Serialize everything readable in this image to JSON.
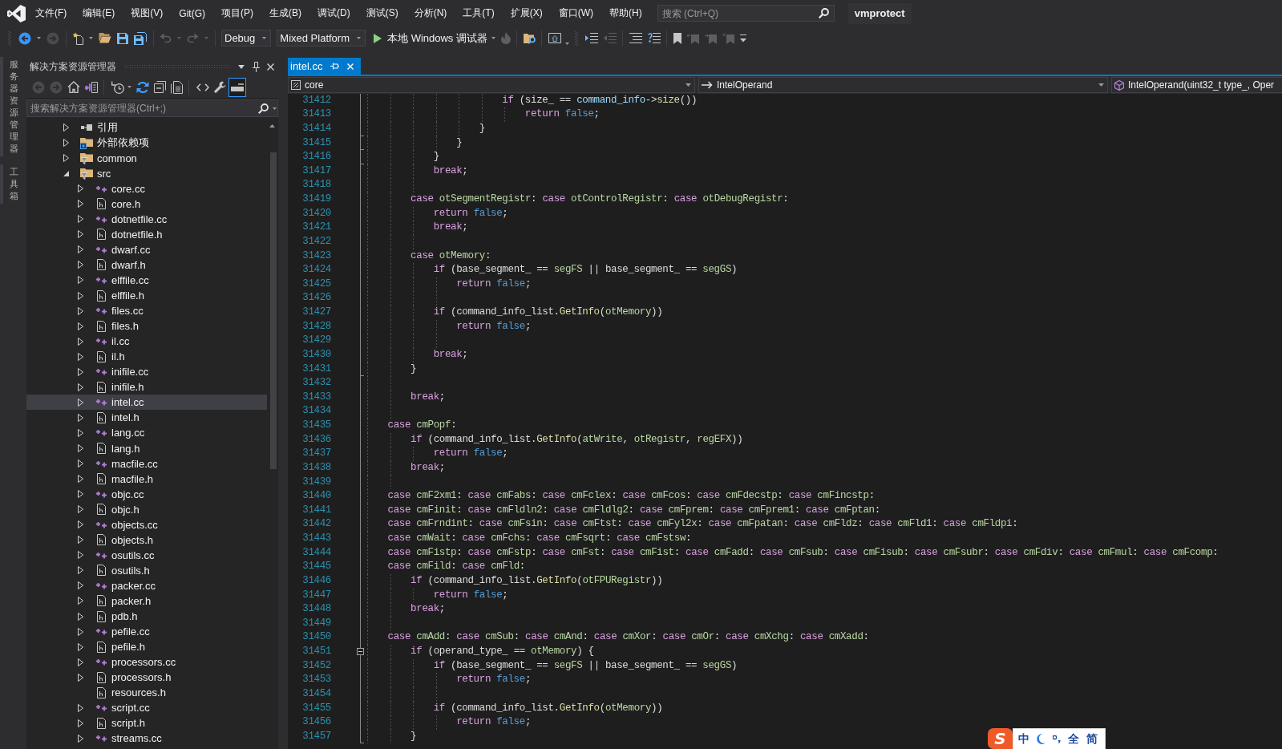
{
  "menu_bar": {
    "items": [
      "文件(F)",
      "编辑(E)",
      "视图(V)",
      "Git(G)",
      "项目(P)",
      "生成(B)",
      "调试(D)",
      "测试(S)",
      "分析(N)",
      "工具(T)",
      "扩展(X)",
      "窗口(W)",
      "帮助(H)"
    ],
    "search": {
      "placeholder": "搜索 (Ctrl+Q)"
    },
    "solution_name": "vmprotect"
  },
  "toolbars": [
    {
      "groups": [
        {
          "items": [
            {
              "kind": "back",
              "disabled": false
            },
            {
              "kind": "forward",
              "disabled": true
            }
          ]
        },
        {
          "items": [
            {
              "kind": "new-item",
              "disabled": false
            },
            {
              "kind": "open",
              "disabled": false
            },
            {
              "kind": "save",
              "disabled": false
            },
            {
              "kind": "save-all",
              "disabled": false
            }
          ]
        },
        {
          "items": [
            {
              "kind": "undo",
              "disabled": true
            },
            {
              "kind": "redo",
              "disabled": true
            }
          ]
        },
        {
          "items": [
            {
              "kind": "dropdown",
              "value": "Debug",
              "disabled": false
            },
            {
              "kind": "dropdown",
              "value": "Mixed Platform",
              "disabled": false
            },
            {
              "kind": "start",
              "label": "本地 Windows 调试器",
              "disabled": false
            },
            {
              "kind": "hot-reload",
              "disabled": true
            }
          ]
        },
        {
          "items": [
            {
              "kind": "find-in-files",
              "disabled": false
            }
          ]
        },
        {
          "items": [
            {
              "kind": "browser-link",
              "disabled": false
            }
          ]
        }
      ]
    },
    {
      "groups": [
        {
          "items": [
            {
              "kind": "indent",
              "disabled": false
            },
            {
              "kind": "outdent",
              "disabled": true
            }
          ]
        },
        {
          "items": [
            {
              "kind": "comment",
              "disabled": false
            },
            {
              "kind": "uncomment",
              "disabled": false
            }
          ]
        },
        {
          "items": [
            {
              "kind": "bookmark",
              "disabled": false
            },
            {
              "kind": "previous-bookmark",
              "disabled": true
            },
            {
              "kind": "next-bookmark",
              "disabled": true
            },
            {
              "kind": "clear-bookmarks",
              "disabled": true
            },
            {
              "kind": "options",
              "disabled": false
            }
          ]
        }
      ]
    }
  ],
  "side_tabs": [
    "服务器资源管理器",
    "工具箱"
  ],
  "solution_explorer": {
    "title": "解决方案资源管理器",
    "toolbar": {
      "groups": [
        {
          "items": [
            {
              "kind": "back",
              "disabled": true,
              "pressed": false
            },
            {
              "kind": "forward",
              "disabled": true,
              "pressed": false
            },
            {
              "kind": "home",
              "disabled": false,
              "pressed": false
            },
            {
              "kind": "switch-views",
              "disabled": false,
              "pressed": false
            }
          ]
        },
        {
          "items": [
            {
              "kind": "history",
              "disabled": false,
              "pressed": false
            },
            {
              "kind": "sync",
              "disabled": false,
              "pressed": false
            },
            {
              "kind": "collapse-all",
              "disabled": false,
              "pressed": false
            },
            {
              "kind": "show-all-files",
              "disabled": false,
              "pressed": false
            }
          ]
        },
        {
          "items": [
            {
              "kind": "code",
              "disabled": false,
              "pressed": false
            },
            {
              "kind": "properties",
              "disabled": false,
              "pressed": false
            },
            {
              "kind": "preview",
              "disabled": false,
              "pressed": true
            }
          ]
        }
      ]
    },
    "search": {
      "placeholder": "搜索解决方案资源管理器(Ctrl+;)"
    },
    "tree": [
      {
        "label": "引用",
        "kind": "references",
        "expandable": true,
        "expanded": false,
        "selected": false
      },
      {
        "label": "外部依赖项",
        "kind": "external",
        "expandable": true,
        "expanded": false,
        "selected": false
      },
      {
        "label": "common",
        "kind": "filter",
        "expandable": true,
        "expanded": false,
        "selected": false
      },
      {
        "label": "src",
        "kind": "filter",
        "expandable": true,
        "expanded": true,
        "selected": false,
        "children": [
          {
            "label": "core.cc",
            "kind": "source",
            "expandable": true,
            "expanded": false,
            "selected": false
          },
          {
            "label": "core.h",
            "kind": "header",
            "expandable": true,
            "expanded": false,
            "selected": false
          },
          {
            "label": "dotnetfile.cc",
            "kind": "source",
            "expandable": true,
            "expanded": false,
            "selected": false
          },
          {
            "label": "dotnetfile.h",
            "kind": "header",
            "expandable": true,
            "expanded": false,
            "selected": false
          },
          {
            "label": "dwarf.cc",
            "kind": "source",
            "expandable": true,
            "expanded": false,
            "selected": false
          },
          {
            "label": "dwarf.h",
            "kind": "header",
            "expandable": true,
            "expanded": false,
            "selected": false
          },
          {
            "label": "elffile.cc",
            "kind": "source",
            "expandable": true,
            "expanded": false,
            "selected": false
          },
          {
            "label": "elffile.h",
            "kind": "header",
            "expandable": true,
            "expanded": false,
            "selected": false
          },
          {
            "label": "files.cc",
            "kind": "source",
            "expandable": true,
            "expanded": false,
            "selected": false
          },
          {
            "label": "files.h",
            "kind": "header",
            "expandable": true,
            "expanded": false,
            "selected": false
          },
          {
            "label": "il.cc",
            "kind": "source",
            "expandable": true,
            "expanded": false,
            "selected": false
          },
          {
            "label": "il.h",
            "kind": "header",
            "expandable": true,
            "expanded": false,
            "selected": false
          },
          {
            "label": "inifile.cc",
            "kind": "source",
            "expandable": true,
            "expanded": false,
            "selected": false
          },
          {
            "label": "inifile.h",
            "kind": "header",
            "expandable": true,
            "expanded": false,
            "selected": false
          },
          {
            "label": "intel.cc",
            "kind": "source",
            "expandable": true,
            "expanded": false,
            "selected": true
          },
          {
            "label": "intel.h",
            "kind": "header",
            "expandable": true,
            "expanded": false,
            "selected": false
          },
          {
            "label": "lang.cc",
            "kind": "source",
            "expandable": true,
            "expanded": false,
            "selected": false
          },
          {
            "label": "lang.h",
            "kind": "header",
            "expandable": true,
            "expanded": false,
            "selected": false
          },
          {
            "label": "macfile.cc",
            "kind": "source",
            "expandable": true,
            "expanded": false,
            "selected": false
          },
          {
            "label": "macfile.h",
            "kind": "header",
            "expandable": true,
            "expanded": false,
            "selected": false
          },
          {
            "label": "objc.cc",
            "kind": "source",
            "expandable": true,
            "expanded": false,
            "selected": false
          },
          {
            "label": "objc.h",
            "kind": "header",
            "expandable": true,
            "expanded": false,
            "selected": false
          },
          {
            "label": "objects.cc",
            "kind": "source",
            "expandable": true,
            "expanded": false,
            "selected": false
          },
          {
            "label": "objects.h",
            "kind": "header",
            "expandable": true,
            "expanded": false,
            "selected": false
          },
          {
            "label": "osutils.cc",
            "kind": "source",
            "expandable": true,
            "expanded": false,
            "selected": false
          },
          {
            "label": "osutils.h",
            "kind": "header",
            "expandable": true,
            "expanded": false,
            "selected": false
          },
          {
            "label": "packer.cc",
            "kind": "source",
            "expandable": true,
            "expanded": false,
            "selected": false
          },
          {
            "label": "packer.h",
            "kind": "header",
            "expandable": true,
            "expanded": false,
            "selected": false
          },
          {
            "label": "pdb.h",
            "kind": "header",
            "expandable": true,
            "expanded": false,
            "selected": false
          },
          {
            "label": "pefile.cc",
            "kind": "source",
            "expandable": true,
            "expanded": false,
            "selected": false
          },
          {
            "label": "pefile.h",
            "kind": "header",
            "expandable": true,
            "expanded": false,
            "selected": false
          },
          {
            "label": "processors.cc",
            "kind": "source",
            "expandable": true,
            "expanded": false,
            "selected": false
          },
          {
            "label": "processors.h",
            "kind": "header",
            "expandable": true,
            "expanded": false,
            "selected": false
          },
          {
            "label": "resources.h",
            "kind": "header",
            "expandable": false,
            "expanded": false,
            "selected": false
          },
          {
            "label": "script.cc",
            "kind": "source",
            "expandable": true,
            "expanded": false,
            "selected": false
          },
          {
            "label": "script.h",
            "kind": "header",
            "expandable": true,
            "expanded": false,
            "selected": false
          },
          {
            "label": "streams.cc",
            "kind": "source",
            "expandable": true,
            "expanded": false,
            "selected": false
          }
        ]
      }
    ]
  },
  "editor": {
    "tabs": [
      {
        "label": "intel.cc",
        "selected": true
      }
    ],
    "navigation": [
      {
        "kind": "project",
        "text": "core"
      },
      {
        "kind": "type",
        "text": "IntelOperand"
      },
      {
        "kind": "member",
        "text": "IntelOperand(uint32_t type_, Oper"
      }
    ],
    "lines": [
      {
        "kind": "code",
        "number": "31412",
        "segments": [
          {
            "kind": "keyword",
            "text": "\t\t\t\t\t\tif"
          },
          {
            "kind": "plain",
            "text": " (size_ == "
          },
          {
            "kind": "parameter",
            "text": "command_info"
          },
          {
            "kind": "plain",
            "text": "->"
          },
          {
            "kind": "function",
            "text": "size"
          },
          {
            "kind": "plain",
            "text": "())"
          }
        ]
      },
      {
        "kind": "code",
        "number": "31413",
        "segments": [
          {
            "kind": "keyword",
            "text": "\t\t\t\t\t\t\treturn"
          },
          {
            "kind": "literal",
            "text": " false"
          },
          {
            "kind": "plain",
            "text": ";"
          }
        ]
      },
      {
        "kind": "region-end",
        "number": "31414",
        "segments": [
          {
            "kind": "plain",
            "text": "\t\t\t\t\t}"
          }
        ]
      },
      {
        "kind": "region-end",
        "number": "31415",
        "segments": [
          {
            "kind": "plain",
            "text": "\t\t\t\t}"
          }
        ]
      },
      {
        "kind": "region-end",
        "number": "31416",
        "segments": [
          {
            "kind": "plain",
            "text": "\t\t\t}"
          }
        ]
      },
      {
        "kind": "code",
        "number": "31417",
        "segments": [
          {
            "kind": "keyword",
            "text": "\t\t\tbreak"
          },
          {
            "kind": "plain",
            "text": ";"
          }
        ]
      },
      {
        "kind": "blank",
        "number": "31418"
      },
      {
        "kind": "code",
        "number": "31419",
        "segments": [
          {
            "kind": "keyword",
            "text": "\t\tcase"
          },
          {
            "kind": "enum",
            "text": " otSegmentRegistr"
          },
          {
            "kind": "plain",
            "text": ": "
          },
          {
            "kind": "keyword",
            "text": "case"
          },
          {
            "kind": "enum",
            "text": " otControlRegistr"
          },
          {
            "kind": "plain",
            "text": ": "
          },
          {
            "kind": "keyword",
            "text": "case"
          },
          {
            "kind": "enum",
            "text": " otDebugRegistr"
          },
          {
            "kind": "plain",
            "text": ":"
          }
        ]
      },
      {
        "kind": "code",
        "number": "31420",
        "segments": [
          {
            "kind": "keyword",
            "text": "\t\t\treturn"
          },
          {
            "kind": "literal",
            "text": " false"
          },
          {
            "kind": "plain",
            "text": ";"
          }
        ]
      },
      {
        "kind": "code",
        "number": "31421",
        "segments": [
          {
            "kind": "keyword",
            "text": "\t\t\tbreak"
          },
          {
            "kind": "plain",
            "text": ";"
          }
        ]
      },
      {
        "kind": "blank",
        "number": "31422"
      },
      {
        "kind": "code",
        "number": "31423",
        "segments": [
          {
            "kind": "keyword",
            "text": "\t\tcase"
          },
          {
            "kind": "enum",
            "text": " otMemory"
          },
          {
            "kind": "plain",
            "text": ":"
          }
        ]
      },
      {
        "kind": "code",
        "number": "31424",
        "segments": [
          {
            "kind": "keyword",
            "text": "\t\t\tif"
          },
          {
            "kind": "plain",
            "text": " (base_segment_ == "
          },
          {
            "kind": "enum",
            "text": "segFS"
          },
          {
            "kind": "plain",
            "text": " || base_segment_ == "
          },
          {
            "kind": "enum",
            "text": "segGS"
          },
          {
            "kind": "plain",
            "text": ")"
          }
        ]
      },
      {
        "kind": "code",
        "number": "31425",
        "segments": [
          {
            "kind": "keyword",
            "text": "\t\t\t\treturn"
          },
          {
            "kind": "literal",
            "text": " false"
          },
          {
            "kind": "plain",
            "text": ";"
          }
        ]
      },
      {
        "kind": "blank",
        "number": "31426"
      },
      {
        "kind": "code",
        "number": "31427",
        "segments": [
          {
            "kind": "keyword",
            "text": "\t\t\tif"
          },
          {
            "kind": "plain",
            "text": " (command_info_list."
          },
          {
            "kind": "function",
            "text": "GetInfo"
          },
          {
            "kind": "plain",
            "text": "("
          },
          {
            "kind": "enum",
            "text": "otMemory"
          },
          {
            "kind": "plain",
            "text": "))"
          }
        ]
      },
      {
        "kind": "code",
        "number": "31428",
        "segments": [
          {
            "kind": "keyword",
            "text": "\t\t\t\treturn"
          },
          {
            "kind": "literal",
            "text": " false"
          },
          {
            "kind": "plain",
            "text": ";"
          }
        ]
      },
      {
        "kind": "blank",
        "number": "31429"
      },
      {
        "kind": "code",
        "number": "31430",
        "segments": [
          {
            "kind": "keyword",
            "text": "\t\t\tbreak"
          },
          {
            "kind": "plain",
            "text": ";"
          }
        ]
      },
      {
        "kind": "region-end",
        "number": "31431",
        "segments": [
          {
            "kind": "plain",
            "text": "\t\t}"
          }
        ]
      },
      {
        "kind": "blank",
        "number": "31432"
      },
      {
        "kind": "code",
        "number": "31433",
        "segments": [
          {
            "kind": "keyword",
            "text": "\t\tbreak"
          },
          {
            "kind": "plain",
            "text": ";"
          }
        ]
      },
      {
        "kind": "blank",
        "number": "31434"
      },
      {
        "kind": "code",
        "number": "31435",
        "segments": [
          {
            "kind": "keyword",
            "text": "\tcase"
          },
          {
            "kind": "enum",
            "text": " cmPopf"
          },
          {
            "kind": "plain",
            "text": ":"
          }
        ]
      },
      {
        "kind": "code",
        "number": "31436",
        "segments": [
          {
            "kind": "keyword",
            "text": "\t\tif"
          },
          {
            "kind": "plain",
            "text": " (command_info_list."
          },
          {
            "kind": "function",
            "text": "GetInfo"
          },
          {
            "kind": "plain",
            "text": "("
          },
          {
            "kind": "enum",
            "text": "atWrite"
          },
          {
            "kind": "plain",
            "text": ", "
          },
          {
            "kind": "enum",
            "text": "otRegistr"
          },
          {
            "kind": "plain",
            "text": ", "
          },
          {
            "kind": "enum",
            "text": "regEFX"
          },
          {
            "kind": "plain",
            "text": "))"
          }
        ]
      },
      {
        "kind": "code",
        "number": "31437",
        "segments": [
          {
            "kind": "keyword",
            "text": "\t\t\treturn"
          },
          {
            "kind": "literal",
            "text": " false"
          },
          {
            "kind": "plain",
            "text": ";"
          }
        ]
      },
      {
        "kind": "code",
        "number": "31438",
        "segments": [
          {
            "kind": "keyword",
            "text": "\t\tbreak"
          },
          {
            "kind": "plain",
            "text": ";"
          }
        ]
      },
      {
        "kind": "blank",
        "number": "31439"
      },
      {
        "kind": "code",
        "number": "31440",
        "segments": [
          {
            "kind": "keyword",
            "text": "\tcase"
          },
          {
            "kind": "enum",
            "text": " cmF2xm1"
          },
          {
            "kind": "plain",
            "text": ": "
          },
          {
            "kind": "keyword",
            "text": "case"
          },
          {
            "kind": "enum",
            "text": " cmFabs"
          },
          {
            "kind": "plain",
            "text": ": "
          },
          {
            "kind": "keyword",
            "text": "case"
          },
          {
            "kind": "enum",
            "text": " cmFclex"
          },
          {
            "kind": "plain",
            "text": ": "
          },
          {
            "kind": "keyword",
            "text": "case"
          },
          {
            "kind": "enum",
            "text": " cmFcos"
          },
          {
            "kind": "plain",
            "text": ": "
          },
          {
            "kind": "keyword",
            "text": "case"
          },
          {
            "kind": "enum",
            "text": " cmFdecstp"
          },
          {
            "kind": "plain",
            "text": ": "
          },
          {
            "kind": "keyword",
            "text": "case"
          },
          {
            "kind": "enum",
            "text": " cmFincstp"
          },
          {
            "kind": "plain",
            "text": ":"
          }
        ]
      },
      {
        "kind": "code",
        "number": "31441",
        "segments": [
          {
            "kind": "keyword",
            "text": "\tcase"
          },
          {
            "kind": "enum",
            "text": " cmFinit"
          },
          {
            "kind": "plain",
            "text": ": "
          },
          {
            "kind": "keyword",
            "text": "case"
          },
          {
            "kind": "enum",
            "text": " cmFldln2"
          },
          {
            "kind": "plain",
            "text": ": "
          },
          {
            "kind": "keyword",
            "text": "case"
          },
          {
            "kind": "enum",
            "text": " cmFldlg2"
          },
          {
            "kind": "plain",
            "text": ": "
          },
          {
            "kind": "keyword",
            "text": "case"
          },
          {
            "kind": "enum",
            "text": " cmFprem"
          },
          {
            "kind": "plain",
            "text": ": "
          },
          {
            "kind": "keyword",
            "text": "case"
          },
          {
            "kind": "enum",
            "text": " cmFprem1"
          },
          {
            "kind": "plain",
            "text": ": "
          },
          {
            "kind": "keyword",
            "text": "case"
          },
          {
            "kind": "enum",
            "text": " cmFptan"
          },
          {
            "kind": "plain",
            "text": ":"
          }
        ]
      },
      {
        "kind": "code",
        "number": "31442",
        "segments": [
          {
            "kind": "keyword",
            "text": "\tcase"
          },
          {
            "kind": "enum",
            "text": " cmFrndint"
          },
          {
            "kind": "plain",
            "text": ": "
          },
          {
            "kind": "keyword",
            "text": "case"
          },
          {
            "kind": "enum",
            "text": " cmFsin"
          },
          {
            "kind": "plain",
            "text": ": "
          },
          {
            "kind": "keyword",
            "text": "case"
          },
          {
            "kind": "enum",
            "text": " cmFtst"
          },
          {
            "kind": "plain",
            "text": ": "
          },
          {
            "kind": "keyword",
            "text": "case"
          },
          {
            "kind": "enum",
            "text": " cmFyl2x"
          },
          {
            "kind": "plain",
            "text": ": "
          },
          {
            "kind": "keyword",
            "text": "case"
          },
          {
            "kind": "enum",
            "text": " cmFpatan"
          },
          {
            "kind": "plain",
            "text": ": "
          },
          {
            "kind": "keyword",
            "text": "case"
          },
          {
            "kind": "enum",
            "text": " cmFldz"
          },
          {
            "kind": "plain",
            "text": ": "
          },
          {
            "kind": "keyword",
            "text": "case"
          },
          {
            "kind": "enum",
            "text": " cmFld1"
          },
          {
            "kind": "plain",
            "text": ": "
          },
          {
            "kind": "keyword",
            "text": "case"
          },
          {
            "kind": "enum",
            "text": " cmFldpi"
          },
          {
            "kind": "plain",
            "text": ":"
          }
        ]
      },
      {
        "kind": "code",
        "number": "31443",
        "segments": [
          {
            "kind": "keyword",
            "text": "\tcase"
          },
          {
            "kind": "enum",
            "text": " cmWait"
          },
          {
            "kind": "plain",
            "text": ": "
          },
          {
            "kind": "keyword",
            "text": "case"
          },
          {
            "kind": "enum",
            "text": " cmFchs"
          },
          {
            "kind": "plain",
            "text": ": "
          },
          {
            "kind": "keyword",
            "text": "case"
          },
          {
            "kind": "enum",
            "text": " cmFsqrt"
          },
          {
            "kind": "plain",
            "text": ": "
          },
          {
            "kind": "keyword",
            "text": "case"
          },
          {
            "kind": "enum",
            "text": " cmFstsw"
          },
          {
            "kind": "plain",
            "text": ":"
          }
        ]
      },
      {
        "kind": "code",
        "number": "31444",
        "segments": [
          {
            "kind": "keyword",
            "text": "\tcase"
          },
          {
            "kind": "enum",
            "text": " cmFistp"
          },
          {
            "kind": "plain",
            "text": ": "
          },
          {
            "kind": "keyword",
            "text": "case"
          },
          {
            "kind": "enum",
            "text": " cmFstp"
          },
          {
            "kind": "plain",
            "text": ": "
          },
          {
            "kind": "keyword",
            "text": "case"
          },
          {
            "kind": "enum",
            "text": " cmFst"
          },
          {
            "kind": "plain",
            "text": ": "
          },
          {
            "kind": "keyword",
            "text": "case"
          },
          {
            "kind": "enum",
            "text": " cmFist"
          },
          {
            "kind": "plain",
            "text": ": "
          },
          {
            "kind": "keyword",
            "text": "case"
          },
          {
            "kind": "enum",
            "text": " cmFadd"
          },
          {
            "kind": "plain",
            "text": ": "
          },
          {
            "kind": "keyword",
            "text": "case"
          },
          {
            "kind": "enum",
            "text": " cmFsub"
          },
          {
            "kind": "plain",
            "text": ": "
          },
          {
            "kind": "keyword",
            "text": "case"
          },
          {
            "kind": "enum",
            "text": " cmFisub"
          },
          {
            "kind": "plain",
            "text": ": "
          },
          {
            "kind": "keyword",
            "text": "case"
          },
          {
            "kind": "enum",
            "text": " cmFsubr"
          },
          {
            "kind": "plain",
            "text": ": "
          },
          {
            "kind": "keyword",
            "text": "case"
          },
          {
            "kind": "enum",
            "text": " cmFdiv"
          },
          {
            "kind": "plain",
            "text": ": "
          },
          {
            "kind": "keyword",
            "text": "case"
          },
          {
            "kind": "enum",
            "text": " cmFmul"
          },
          {
            "kind": "plain",
            "text": ": "
          },
          {
            "kind": "keyword",
            "text": "case"
          },
          {
            "kind": "enum",
            "text": " cmFcomp"
          },
          {
            "kind": "plain",
            "text": ":"
          }
        ]
      },
      {
        "kind": "code",
        "number": "31445",
        "segments": [
          {
            "kind": "keyword",
            "text": "\tcase"
          },
          {
            "kind": "enum",
            "text": " cmFild"
          },
          {
            "kind": "plain",
            "text": ": "
          },
          {
            "kind": "keyword",
            "text": "case"
          },
          {
            "kind": "enum",
            "text": " cmFld"
          },
          {
            "kind": "plain",
            "text": ":"
          }
        ]
      },
      {
        "kind": "code",
        "number": "31446",
        "segments": [
          {
            "kind": "keyword",
            "text": "\t\tif"
          },
          {
            "kind": "plain",
            "text": " (command_info_list."
          },
          {
            "kind": "function",
            "text": "GetInfo"
          },
          {
            "kind": "plain",
            "text": "("
          },
          {
            "kind": "enum",
            "text": "otFPURegistr"
          },
          {
            "kind": "plain",
            "text": "))"
          }
        ]
      },
      {
        "kind": "code",
        "number": "31447",
        "segments": [
          {
            "kind": "keyword",
            "text": "\t\t\treturn"
          },
          {
            "kind": "literal",
            "text": " false"
          },
          {
            "kind": "plain",
            "text": ";"
          }
        ]
      },
      {
        "kind": "code",
        "number": "31448",
        "segments": [
          {
            "kind": "keyword",
            "text": "\t\tbreak"
          },
          {
            "kind": "plain",
            "text": ";"
          }
        ]
      },
      {
        "kind": "blank",
        "number": "31449"
      },
      {
        "kind": "code",
        "number": "31450",
        "segments": [
          {
            "kind": "keyword",
            "text": "\tcase"
          },
          {
            "kind": "enum",
            "text": " cmAdd"
          },
          {
            "kind": "plain",
            "text": ": "
          },
          {
            "kind": "keyword",
            "text": "case"
          },
          {
            "kind": "enum",
            "text": " cmSub"
          },
          {
            "kind": "plain",
            "text": ": "
          },
          {
            "kind": "keyword",
            "text": "case"
          },
          {
            "kind": "enum",
            "text": " cmAnd"
          },
          {
            "kind": "plain",
            "text": ": "
          },
          {
            "kind": "keyword",
            "text": "case"
          },
          {
            "kind": "enum",
            "text": " cmXor"
          },
          {
            "kind": "plain",
            "text": ": "
          },
          {
            "kind": "keyword",
            "text": "case"
          },
          {
            "kind": "enum",
            "text": " cmOr"
          },
          {
            "kind": "plain",
            "text": ": "
          },
          {
            "kind": "keyword",
            "text": "case"
          },
          {
            "kind": "enum",
            "text": " cmXchg"
          },
          {
            "kind": "plain",
            "text": ": "
          },
          {
            "kind": "keyword",
            "text": "case"
          },
          {
            "kind": "enum",
            "text": " cmXadd"
          },
          {
            "kind": "plain",
            "text": ":"
          }
        ]
      },
      {
        "kind": "region-start",
        "expanded": true,
        "number": "31451",
        "segments": [
          {
            "kind": "keyword",
            "text": "\t\tif"
          },
          {
            "kind": "plain",
            "text": " (operand_type_ == "
          },
          {
            "kind": "enum",
            "text": "otMemory"
          },
          {
            "kind": "plain",
            "text": ") {"
          }
        ]
      },
      {
        "kind": "code",
        "number": "31452",
        "segments": [
          {
            "kind": "keyword",
            "text": "\t\t\tif"
          },
          {
            "kind": "plain",
            "text": " (base_segment_ == "
          },
          {
            "kind": "enum",
            "text": "segFS"
          },
          {
            "kind": "plain",
            "text": " || base_segment_ == "
          },
          {
            "kind": "enum",
            "text": "segGS"
          },
          {
            "kind": "plain",
            "text": ")"
          }
        ]
      },
      {
        "kind": "code",
        "number": "31453",
        "segments": [
          {
            "kind": "keyword",
            "text": "\t\t\t\treturn"
          },
          {
            "kind": "literal",
            "text": " false"
          },
          {
            "kind": "plain",
            "text": ";"
          }
        ]
      },
      {
        "kind": "blank",
        "number": "31454"
      },
      {
        "kind": "code",
        "number": "31455",
        "segments": [
          {
            "kind": "keyword",
            "text": "\t\t\tif"
          },
          {
            "kind": "plain",
            "text": " (command_info_list."
          },
          {
            "kind": "function",
            "text": "GetInfo"
          },
          {
            "kind": "plain",
            "text": "("
          },
          {
            "kind": "enum",
            "text": "otMemory"
          },
          {
            "kind": "plain",
            "text": "))"
          }
        ]
      },
      {
        "kind": "code",
        "number": "31456",
        "segments": [
          {
            "kind": "keyword",
            "text": "\t\t\t\treturn"
          },
          {
            "kind": "literal",
            "text": " false"
          },
          {
            "kind": "plain",
            "text": ";"
          }
        ]
      },
      {
        "kind": "region-end",
        "number": "31457",
        "segments": [
          {
            "kind": "plain",
            "text": "\t\t}"
          }
        ]
      }
    ]
  },
  "input_method": {
    "logo": "S",
    "mode": "中",
    "width": "全",
    "script": "简"
  }
}
